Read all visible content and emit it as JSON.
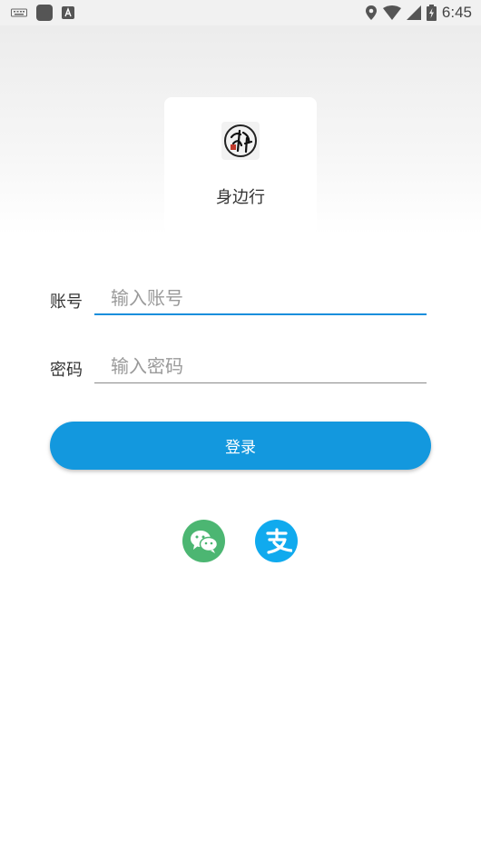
{
  "status_bar": {
    "time": "6:45",
    "icons": [
      "keyboard-icon",
      "app-square-icon",
      "a-notification-icon",
      "location-icon",
      "wifi-icon",
      "signal-icon",
      "battery-charging-icon"
    ]
  },
  "app": {
    "name": "身边行",
    "logo_icon": "app-logo-calligraphy-icon"
  },
  "form": {
    "account_label": "账号",
    "account_placeholder": "输入账号",
    "account_value": "",
    "password_label": "密码",
    "password_placeholder": "输入密码",
    "password_value": "",
    "login_label": "登录"
  },
  "social_login": {
    "items": [
      {
        "icon": "wechat-icon",
        "color": "#4cb672"
      },
      {
        "icon": "alipay-icon",
        "color": "#10aaee"
      }
    ]
  },
  "colors": {
    "accent": "#1398de",
    "active_underline": "#1a8fdc",
    "wechat": "#4cb672",
    "alipay": "#10aaee"
  }
}
